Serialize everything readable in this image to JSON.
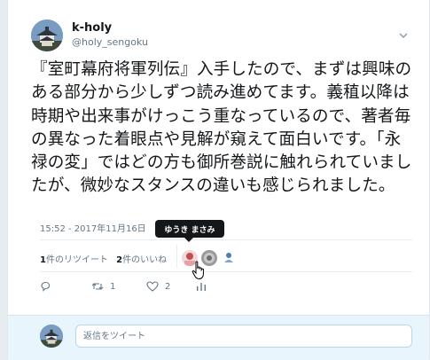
{
  "author": {
    "display_name": "k-holy",
    "username": "@holy_sengoku",
    "avatar_icon": "castle-avatar-icon"
  },
  "tweet": {
    "text": "『室町幕府将軍列伝』入手したので、まずは興味のある部分から少しずつ読み進めてます。義稙以降は時期や出来事がけっこう重なっているので、著者毎の異なった着眼点や見解が窺えて面白いです。「永禄の変」ではどの方も御所巻説に触れられていましたが、微妙なスタンスの違いも感じられました。",
    "timestamp": "15:52 - 2017年11月16日"
  },
  "stats": {
    "retweets_count": "1",
    "retweets_label": "件のリツイート",
    "likes_count": "2",
    "likes_label": "件のいいね"
  },
  "tooltip": {
    "text": "ゆうき まさみ"
  },
  "actions": {
    "reply_count": "",
    "retweet_count": "1",
    "like_count": "2"
  },
  "reply": {
    "placeholder": "返信をツイート"
  },
  "colors": {
    "text": "#14171a",
    "secondary": "#657786",
    "reply_area": "#e8f5fd",
    "tooltip_bg": "#14171a"
  }
}
